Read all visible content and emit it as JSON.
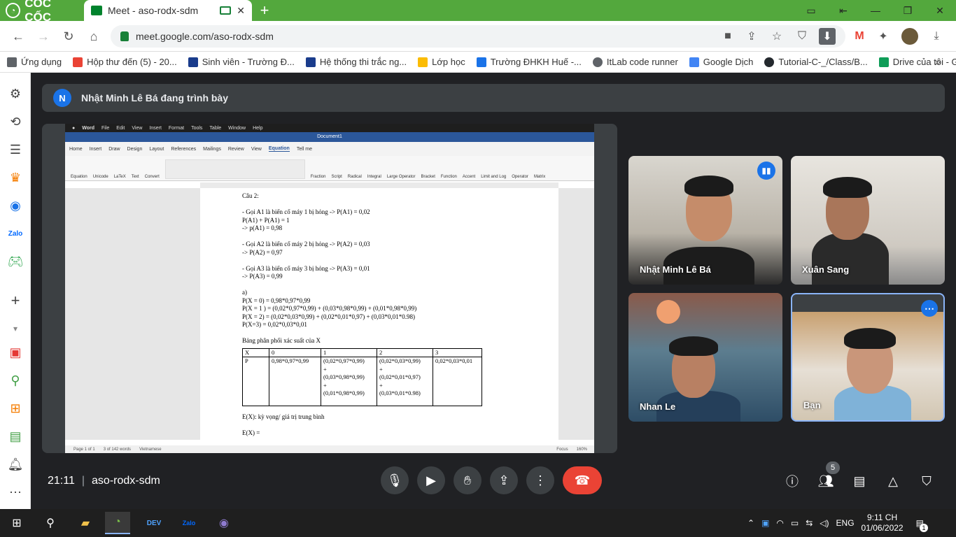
{
  "browser": {
    "brand": "CỐC CỐC",
    "tab_title": "Meet - aso-rodx-sdm",
    "tab_close": "✕",
    "new_tab": "+",
    "url": "meet.google.com/aso-rodx-sdm"
  },
  "bookmarks": [
    {
      "label": "Ứng dụng",
      "color": "#5f6368"
    },
    {
      "label": "Hộp thư đến (5) - 20...",
      "color": "#ea4335"
    },
    {
      "label": "Sinh viên - Trường Đ...",
      "color": "#1a3c8c"
    },
    {
      "label": "Hệ thống thi trắc ng...",
      "color": "#1a3c8c"
    },
    {
      "label": "Lớp học",
      "color": "#fbbc04"
    },
    {
      "label": "Trường ĐHKH Huế -...",
      "color": "#1a73e8"
    },
    {
      "label": "ItLab code runner",
      "color": "#5f6368"
    },
    {
      "label": "Google Dịch",
      "color": "#4285f4"
    },
    {
      "label": "Tutorial-C-_/Class/B...",
      "color": "#24292e"
    },
    {
      "label": "Drive của tôi - Googl...",
      "color": "#0f9d58"
    }
  ],
  "meet": {
    "presenter_initial": "N",
    "presenter_banner": "Nhật Minh Lê Bá đang trình bày",
    "time": "21:11",
    "separator": "|",
    "meeting_code": "aso-rodx-sdm",
    "people_count": "5",
    "participants": [
      {
        "name": "Nhật Minh Lê Bá"
      },
      {
        "name": "Xuân Sang"
      },
      {
        "name": "Nhan Le"
      },
      {
        "name": "Bạn"
      }
    ]
  },
  "word": {
    "mac_menu": [
      "Word",
      "File",
      "Edit",
      "View",
      "Insert",
      "Format",
      "Tools",
      "Table",
      "Window",
      "Help"
    ],
    "doc_title": "Document1",
    "ribbon_tabs": [
      "Home",
      "Insert",
      "Draw",
      "Design",
      "Layout",
      "References",
      "Mailings",
      "Review",
      "View",
      "Equation",
      "Tell me"
    ],
    "active_tab": "Equation",
    "ribbon_items": [
      "Equation",
      "Unicode",
      "LaTeX",
      "Text",
      "Convert",
      "Fraction",
      "Script",
      "Radical",
      "Integral",
      "Large Operator",
      "Bracket",
      "Function",
      "Accent",
      "Limit and Log",
      "Operator",
      "Matrix"
    ],
    "status_left": "Page 1 of 1",
    "status_words": "3 of 142 words",
    "status_lang": "Vietnamese",
    "status_focus": "Focus",
    "status_zoom": "160%",
    "doc_lines": [
      "Câu 2:",
      "",
      "- Gọi A1 là biến cố máy 1 bị hỏng -> P(A1) = 0,02",
      "P(A1) + P(A1) = 1",
      "-> p(A1) = 0,98",
      "",
      "- Gọi A2 là biến cố máy 2 bị hỏng -> P(A2) = 0,03",
      "  -> P(A2) = 0,97",
      "",
      "- Gọi A3 là biến cố máy 3 bị hỏng -> P(A3) = 0,01",
      "-> P(A3) = 0,99",
      "",
      "a)",
      "P(X = 0) = 0,98*0,97*0,99",
      "P(X = 1 ) = (0,02*0,97*0,99) + (0,03*0,98*0,99) + (0,01*0,98*0,99)",
      "P(X = 2) = (0,02*0,03*0,99) + (0,02*0,01*0,97) + (0,03*0,01*0.98)",
      "P(X=3) = 0,02*0,03*0,01",
      "",
      "Bảng phân phối xác suất của X"
    ],
    "table": {
      "header": [
        "X",
        "0",
        "1",
        "2",
        "3"
      ],
      "row_label": "P",
      "col0": "0,98*0,97*0,99",
      "col1": [
        "(0,02*0,97*0,99)",
        "+",
        "(0,03*0,98*0,99)",
        "+",
        "(0,01*0,98*0,99)"
      ],
      "col2": [
        "(0,02*0,03*0,99)",
        "+",
        "(0,02*0,01*0,97)",
        "+",
        "(0,03*0,01*0.98)"
      ],
      "col3": "0,02*0,03*0,01"
    },
    "after_table": [
      "E(X): kỳ vọng/ giá trị trung bình",
      "",
      "E(X) ="
    ]
  },
  "taskbar": {
    "lang": "ENG",
    "time": "9:11 CH",
    "date": "01/06/2022",
    "notif_count": "1"
  }
}
